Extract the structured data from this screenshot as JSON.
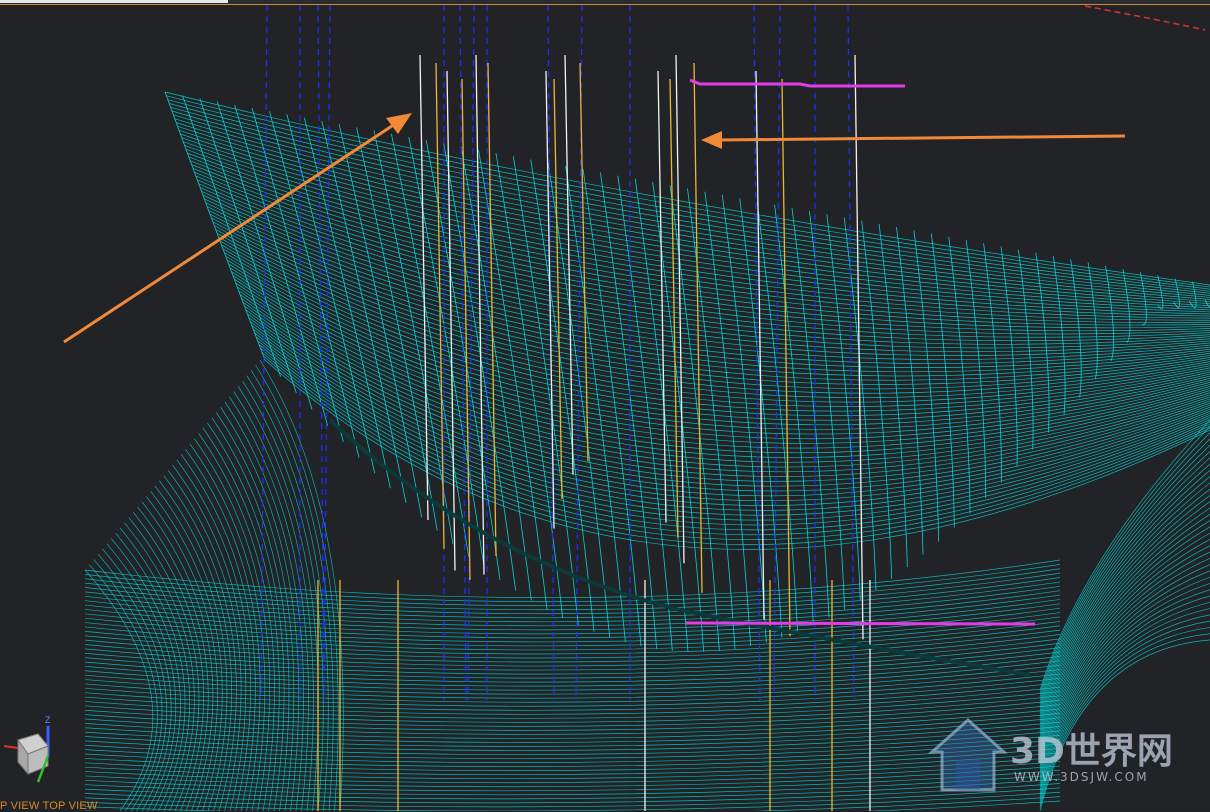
{
  "viewport": {
    "background": "#222327",
    "mesh_color": "#00e5e5",
    "toolpath_yellow": "#e9b735",
    "toolpath_white": "#f2f2f2",
    "rapid_blue": "#1f2fff",
    "highlight_magenta": "#e23ce6",
    "arrow_orange": "#f08a38"
  },
  "view_label": "P VIEW   TOP VIEW",
  "triad": {
    "axis_z": "Z",
    "icon": "view-cube-icon"
  },
  "watermark": {
    "title": "3D世界网",
    "url": "WWW.3DSJW.COM",
    "icon": "house-logo-icon"
  }
}
